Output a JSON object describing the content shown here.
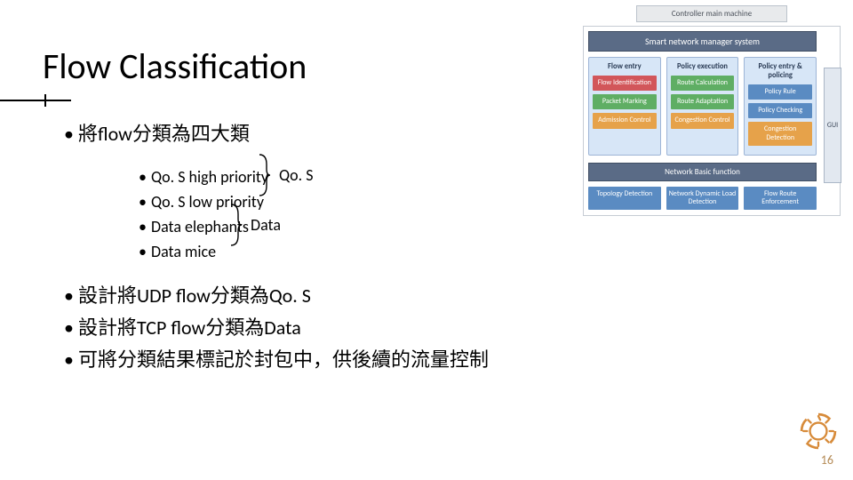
{
  "title": "Flow Classification",
  "bullets": {
    "b1": "將flow分類為四大類",
    "sub": [
      "Qo. S high priority",
      "Qo. S low priority",
      "Data elephants",
      "Data mice"
    ],
    "group1": "Qo. S",
    "group2": "Data",
    "b2": "設計將UDP flow分類為Qo. S",
    "b3": "設計將TCP flow分類為Data",
    "b4": "可將分類結果標記於封包中，供後續的流量控制"
  },
  "diagram": {
    "top": "Controller main machine",
    "system": "Smart network manager system",
    "cols": [
      {
        "h": "Flow entry",
        "boxes": [
          {
            "t": "Flow Identification",
            "c": "bx-red"
          },
          {
            "t": "Packet Marking",
            "c": "bx-grn"
          },
          {
            "t": "Admission Control",
            "c": "bx-org"
          }
        ]
      },
      {
        "h": "Policy execution",
        "boxes": [
          {
            "t": "Route Calculation",
            "c": "bx-grn"
          },
          {
            "t": "Route Adaptation",
            "c": "bx-grn"
          },
          {
            "t": "Congestion Control",
            "c": "bx-org"
          }
        ]
      },
      {
        "h": "Policy entry & policing",
        "boxes": [
          {
            "t": "Policy Rule",
            "c": "bx-blu"
          },
          {
            "t": "Policy Checking",
            "c": "bx-blu"
          },
          {
            "t": "Congestion Detection",
            "c": "bx-org"
          }
        ]
      }
    ],
    "gui": "GUI",
    "basic": "Network Basic function",
    "bottom": [
      {
        "t": "Topology Detection",
        "c": "bx-blu"
      },
      {
        "t": "Network Dynamic Load Detection",
        "c": "bx-blu"
      },
      {
        "t": "Flow Route Enforcement",
        "c": "bx-blu"
      }
    ]
  },
  "page": "16"
}
